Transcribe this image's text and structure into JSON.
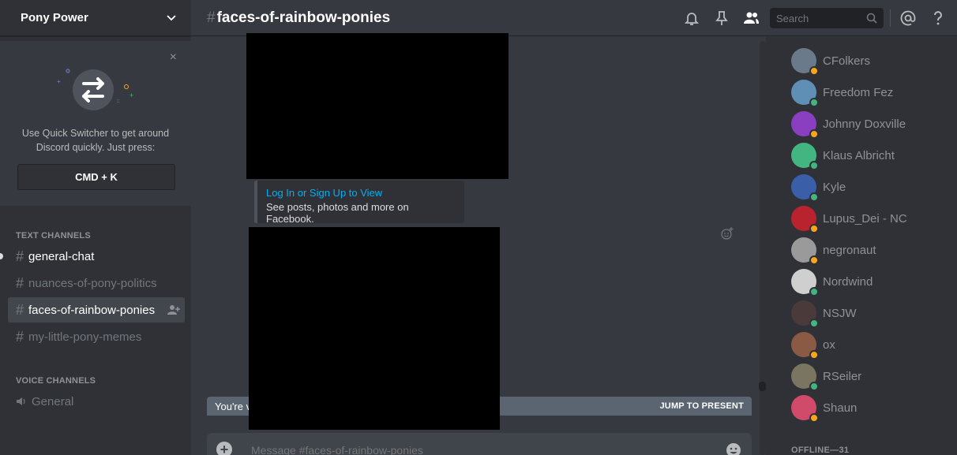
{
  "guild": {
    "name": "Pony Power"
  },
  "quick_switcher": {
    "text": "Use Quick Switcher to get around Discord quickly. Just press:",
    "shortcut": "CMD + K",
    "close": "×"
  },
  "categories": {
    "text": "TEXT CHANNELS",
    "voice": "VOICE CHANNELS"
  },
  "channels": [
    {
      "name": "general-chat"
    },
    {
      "name": "nuances-of-pony-politics"
    },
    {
      "name": "faces-of-rainbow-ponies"
    },
    {
      "name": "my-little-pony-memes"
    }
  ],
  "voice_channels": [
    {
      "name": "General"
    }
  ],
  "header": {
    "channel": "faces-of-rainbow-ponies",
    "hash": "#",
    "search_placeholder": "Search"
  },
  "embed": {
    "title": "Log In or Sign Up to View",
    "description": "See posts, photos and more on Facebook."
  },
  "old_messages": {
    "text": "You're v",
    "jump": "JUMP TO PRESENT"
  },
  "composer": {
    "placeholder": "Message #faces-of-rainbow-ponies"
  },
  "members": [
    {
      "name": "CFolkers",
      "status": "idle",
      "color": "#6b7a8a"
    },
    {
      "name": "Freedom Fez",
      "status": "online",
      "color": "#5f8fb5"
    },
    {
      "name": "Johnny Doxville",
      "status": "idle",
      "color": "#8a3fc0"
    },
    {
      "name": "Klaus Albricht",
      "status": "online",
      "color": "#43b581"
    },
    {
      "name": "Kyle",
      "status": "online",
      "color": "#3a5fa8"
    },
    {
      "name": "Lupus_Dei - NC",
      "status": "idle",
      "color": "#b8232d"
    },
    {
      "name": "negronaut",
      "status": "idle",
      "color": "#9a9a9a"
    },
    {
      "name": "Nordwind",
      "status": "online",
      "color": "#cfcfcf"
    },
    {
      "name": "NSJW",
      "status": "online",
      "color": "#4a3a3a"
    },
    {
      "name": "ox",
      "status": "idle",
      "color": "#8a5a44"
    },
    {
      "name": "RSeiler",
      "status": "online",
      "color": "#7a7560"
    },
    {
      "name": "Shaun",
      "status": "idle",
      "color": "#d04a6a"
    }
  ],
  "offline": {
    "label": "OFFLINE—31"
  },
  "colors": {
    "accent": "#7289da",
    "link": "#00b0f4",
    "online": "#43b581",
    "idle": "#faa61a"
  }
}
